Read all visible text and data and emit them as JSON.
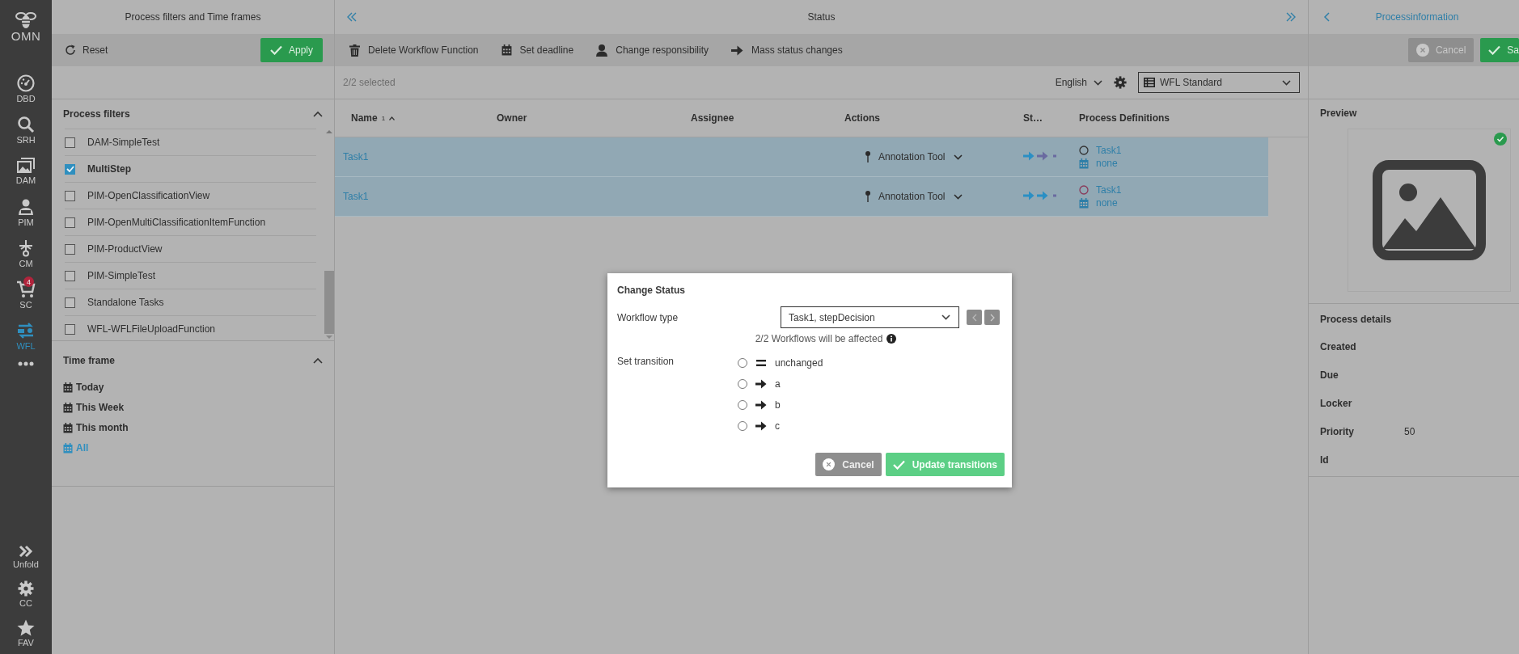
{
  "sidebar": {
    "logo": "OMN",
    "items": [
      {
        "label": "DBD",
        "selected": false
      },
      {
        "label": "SRH",
        "selected": false
      },
      {
        "label": "DAM",
        "selected": false
      },
      {
        "label": "PIM",
        "selected": false
      },
      {
        "label": "CM",
        "selected": false
      },
      {
        "label": "SC",
        "selected": false,
        "badge": "4"
      },
      {
        "label": "WFL",
        "selected": true
      }
    ],
    "bottom_items": [
      {
        "label": "Unfold"
      },
      {
        "label": "CC"
      },
      {
        "label": "FAV"
      }
    ]
  },
  "filter_panel": {
    "title": "Process filters and Time frames",
    "reset": "Reset",
    "apply": "Apply",
    "process_filters": {
      "title": "Process filters",
      "items": [
        {
          "label": "DAM-SimpleTest",
          "checked": false
        },
        {
          "label": "MultiStep",
          "checked": true
        },
        {
          "label": "PIM-OpenClassificationView",
          "checked": false
        },
        {
          "label": "PIM-OpenMultiClassificationItemFunction",
          "checked": false
        },
        {
          "label": "PIM-ProductView",
          "checked": false
        },
        {
          "label": "PIM-SimpleTest",
          "checked": false
        },
        {
          "label": "Standalone Tasks",
          "checked": false
        },
        {
          "label": "WFL-WFLFileUploadFunction",
          "checked": false
        }
      ]
    },
    "time_frame": {
      "title": "Time frame",
      "items": [
        {
          "label": "Today",
          "selected": false
        },
        {
          "label": "This Week",
          "selected": false
        },
        {
          "label": "This month",
          "selected": false
        },
        {
          "label": "All",
          "selected": true
        }
      ]
    }
  },
  "main": {
    "title": "Status",
    "actions": [
      "Delete Workflow Function",
      "Set deadline",
      "Change responsibility",
      "Mass status changes"
    ],
    "selection": "2/2 selected",
    "language": "English",
    "view": "WFL Standard",
    "table": {
      "columns": [
        {
          "label": "Name",
          "sort": "1"
        },
        {
          "label": "Owner"
        },
        {
          "label": "Assignee"
        },
        {
          "label": "Actions"
        },
        {
          "label": "St…"
        },
        {
          "label": "Process Definitions"
        }
      ],
      "rows": [
        {
          "name": "Task1",
          "action": "Annotation Tool",
          "definition": "Task1",
          "deadline": "none",
          "selected": true
        },
        {
          "name": "Task1",
          "action": "Annotation Tool",
          "definition": "Task1",
          "deadline": "none",
          "selected": true
        }
      ]
    }
  },
  "info_panel": {
    "title": "Processinformation",
    "cancel": "Cancel",
    "save": "Sa",
    "preview": "Preview",
    "details_title": "Process details",
    "details": [
      {
        "label": "Created"
      },
      {
        "label": "Due"
      },
      {
        "label": "Locker"
      },
      {
        "label": "Priority",
        "value": "50"
      },
      {
        "label": "Id"
      }
    ]
  },
  "dialog": {
    "title": "Change Status",
    "workflow_label": "Workflow type",
    "workflow_value": "Task1, stepDecision",
    "affected": "2/2 Workflows will be affected",
    "transition_label": "Set transition",
    "transitions": [
      {
        "label": "unchanged",
        "kind": "unchanged",
        "selected": false
      },
      {
        "label": "a",
        "kind": "transition",
        "selected": false
      },
      {
        "label": "b",
        "kind": "transition",
        "selected": false
      },
      {
        "label": "c",
        "kind": "transition",
        "selected": false
      }
    ],
    "cancel": "Cancel",
    "submit": "Update transitions"
  }
}
